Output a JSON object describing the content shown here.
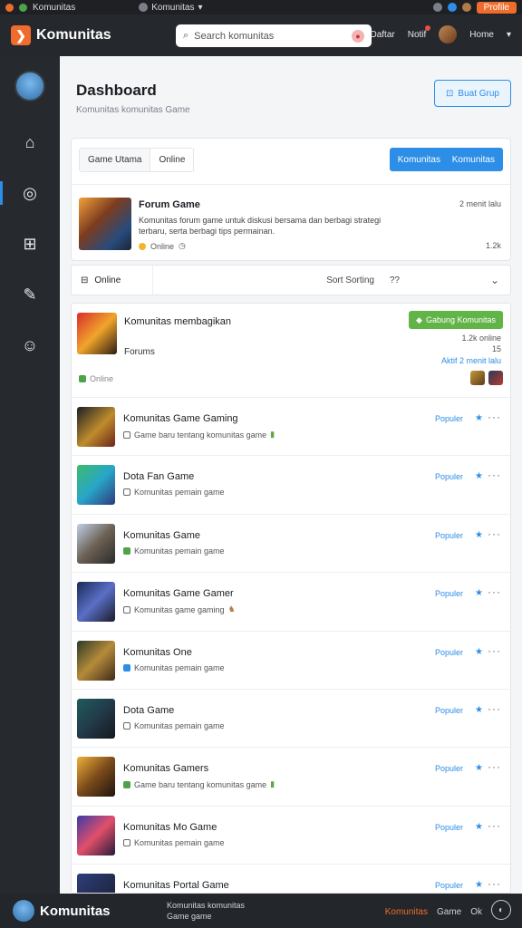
{
  "os_bar": {
    "tab1": "Komunitas",
    "tab2": "Komunitas",
    "right_label": "Profile"
  },
  "header": {
    "brand": "Komunitas",
    "search_value": "Search komunitas",
    "nav_1": "Daftar",
    "nav_2": "Notif",
    "user": "Home"
  },
  "page": {
    "title": "Dashboard",
    "subtitle": "Komunitas komunitas Game",
    "action_button": "Buat Grup"
  },
  "toolbar": {
    "seg_1": "Game Utama",
    "seg_2": "Online",
    "btn_1": "Komunitas",
    "btn_2": "Komunitas"
  },
  "featured": {
    "title": "Forum Game",
    "description": "Komunitas forum game untuk diskusi bersama dan berbagi strategi terbaru, serta berbagi tips permainan.",
    "meta": "Online",
    "time": "2 menit lalu",
    "count": "1.2k"
  },
  "filter": {
    "label": "Online",
    "sort": "Sort Sorting",
    "q": "??"
  },
  "highlight": {
    "title": "Komunitas membagikan",
    "sub": "Forums",
    "online": "Online",
    "join_button": "Gabung Komunitas",
    "r1": "1.2k online",
    "r2": "15",
    "link": "Aktif 2 menit lalu"
  },
  "rows": [
    {
      "title": "Komunitas Game Gaming",
      "meta": "Game baru tentang komunitas game",
      "status": "Populer"
    },
    {
      "title": "Dota Fan Game",
      "meta": "Komunitas pemain game",
      "status": "Populer"
    },
    {
      "title": "Komunitas Game",
      "meta": "Komunitas pemain game",
      "status": "Populer"
    },
    {
      "title": "Komunitas Game Gamer",
      "meta": "Komunitas game gaming",
      "status": "Populer"
    },
    {
      "title": "Komunitas One",
      "meta": "Komunitas pemain game",
      "status": "Populer"
    },
    {
      "title": "Dota Game",
      "meta": "Komunitas pemain game",
      "status": "Populer"
    },
    {
      "title": "Komunitas Gamers",
      "meta": "Game baru tentang komunitas game",
      "status": "Populer"
    },
    {
      "title": "Komunitas Mo Game",
      "meta": "Komunitas pemain game",
      "status": "Populer"
    },
    {
      "title": "Komunitas Portal Game",
      "meta": "",
      "status": "Populer"
    }
  ],
  "footer": {
    "brand": "Komunitas",
    "line1": "Komunitas komunitas",
    "line2": "Game game",
    "link_1": "Komunitas",
    "link_2": "Game",
    "link_3": "Ok"
  },
  "colors": {
    "accent": "#2c8ee6",
    "brand_orange": "#ef6c2c",
    "success": "#62b447",
    "sidebar_bg": "#26292e"
  }
}
